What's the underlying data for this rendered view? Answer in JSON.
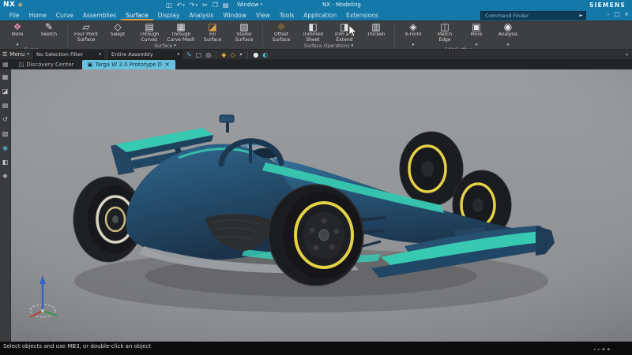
{
  "theme": {
    "blue": "#1478a8",
    "ribbon-bg": "#3e3f41",
    "accent": "#2fc7ae",
    "body-blue": "#1d4a6b",
    "body-dark": "#16354f",
    "yellow": "#e4cf3e",
    "viewport-bg": "#8f9194",
    "active-tab": "#68c2df",
    "orange": "#d79a46"
  },
  "glyphs": {
    "caret": "▾",
    "search": "►",
    "menu": "☰"
  },
  "titlebar": {
    "logo": "NX",
    "badge": {
      "glyph": "❖",
      "name": "app-badge-icon",
      "color": "#d8b36a"
    },
    "title": "NX - Modeling",
    "brand": "SIEMENS",
    "window_menu_label": "Window",
    "quick_access": [
      {
        "glyph": "◫",
        "name": "save-icon"
      },
      {
        "glyph": "↶",
        "name": "undo-icon",
        "caret": "▾"
      },
      {
        "glyph": "↷",
        "name": "redo-icon",
        "caret": "▾"
      },
      {
        "glyph": "✂",
        "name": "cut-icon"
      },
      {
        "glyph": "❐",
        "name": "copy-icon"
      },
      {
        "glyph": "▤",
        "name": "paste-icon"
      }
    ]
  },
  "window_controls": [
    {
      "glyph": "–",
      "name": "minimize-button"
    },
    {
      "glyph": "□",
      "name": "maximize-button"
    },
    {
      "glyph": "×",
      "name": "close-button"
    }
  ],
  "menubar": {
    "tabs": [
      {
        "label": "File"
      },
      {
        "label": "Home"
      },
      {
        "label": "Curve"
      },
      {
        "label": "Assemblies"
      },
      {
        "label": "Surface",
        "active": true
      },
      {
        "label": "Display"
      },
      {
        "label": "Analysis"
      },
      {
        "label": "Window"
      },
      {
        "label": "View"
      },
      {
        "label": "Tools"
      },
      {
        "label": "Application"
      },
      {
        "label": "Extensions"
      }
    ],
    "search_placeholder": "Command Finder"
  },
  "ribbon": {
    "groups": [
      {
        "caption": "Curve",
        "items": [
          {
            "label": "More",
            "glyph": "❖",
            "color": "#df8cab",
            "name": "more-curve-icon",
            "caret": "▾"
          },
          {
            "label": "Sketch",
            "glyph": "✎",
            "color": "#e8e9ea",
            "name": "sketch-icon"
          }
        ]
      },
      {
        "caption": "Surface",
        "items": [
          {
            "label": "Four Point\nSurface",
            "glyph": "▱",
            "name": "four-point-surface-icon"
          },
          {
            "label": "Swept",
            "glyph": "◇",
            "name": "swept-icon"
          },
          {
            "label": "Through\nCurves",
            "glyph": "▤",
            "name": "through-curves-icon"
          },
          {
            "label": "Through\nCurve Mesh",
            "glyph": "▦",
            "name": "through-curve-mesh-icon"
          },
          {
            "label": "Fill\nSurface",
            "glyph": "◪",
            "color": "#e2a33c",
            "name": "fill-surface-icon"
          },
          {
            "label": "Studio\nSurface",
            "glyph": "▧",
            "name": "studio-surface-icon"
          }
        ]
      },
      {
        "caption": "Surface Operations",
        "items": [
          {
            "label": "Offset\nSurface",
            "glyph": "☼",
            "color": "#e2a33c",
            "name": "offset-surface-icon"
          },
          {
            "label": "Trimmed\nSheet",
            "glyph": "◧",
            "name": "trimmed-sheet-icon"
          },
          {
            "label": "Trim and\nExtend",
            "glyph": "◨",
            "name": "trim-and-extend-icon"
          },
          {
            "label": "Thicken",
            "glyph": "▥",
            "name": "thicken-icon"
          }
        ]
      },
      {
        "caption": "Edit Surface",
        "items": [
          {
            "label": "X-Form",
            "glyph": "◈",
            "name": "x-form-icon",
            "caret": "▾"
          },
          {
            "label": "Match\nEdge",
            "glyph": "◫",
            "name": "match-edge-icon"
          },
          {
            "label": "More",
            "glyph": "▣",
            "name": "more-surface-icon",
            "caret": "▾"
          },
          {
            "label": "Analysis",
            "glyph": "◉",
            "name": "analyze-shape-icon",
            "caret": "▾"
          }
        ]
      }
    ]
  },
  "border_bar": {
    "menu_label": "Menu",
    "filter_value": "No Selection Filter",
    "scope_value": "Entire Assembly",
    "icons": [
      {
        "glyph": "✎",
        "color": "#57b8d8",
        "name": "paint-selection-icon"
      },
      {
        "glyph": "▢",
        "name": "rectangle-select-icon"
      },
      {
        "glyph": "◎",
        "name": "find-in-window-icon"
      },
      {
        "type": "divider"
      },
      {
        "glyph": "◆",
        "color": "#dfa23e",
        "name": "snap-point-icon"
      },
      {
        "glyph": "◇",
        "color": "#dfa23e",
        "name": "snap-endpoint-icon"
      },
      {
        "glyph": "•",
        "name": "snap-midpoint-icon"
      },
      {
        "type": "divider"
      },
      {
        "glyph": "●",
        "color": "#e8e9ea",
        "name": "shaded-display-icon"
      },
      {
        "glyph": "◐",
        "color": "#57b8d8",
        "name": "render-style-icon"
      }
    ],
    "overflow_glyph": "▾"
  },
  "part_tabs": {
    "panel_glyph": "▦",
    "tabs": [
      {
        "icon": "◳",
        "label": "Discovery Center"
      },
      {
        "icon": "▣",
        "label": "Targa W 2.0 Prototype D",
        "close": "×",
        "active": true
      }
    ]
  },
  "resource_bar": {
    "icons": [
      {
        "glyph": "▦",
        "name": "assembly-navigator-icon"
      },
      {
        "glyph": "◪",
        "name": "constraint-navigator-icon"
      },
      {
        "glyph": "▤",
        "name": "part-navigator-icon"
      },
      {
        "glyph": "↺",
        "name": "history-icon"
      },
      {
        "glyph": "▧",
        "name": "reuse-library-icon"
      },
      {
        "glyph": "◉",
        "color": "#4fa8d5",
        "name": "web-browser-icon"
      },
      {
        "glyph": "◧",
        "name": "hd3d-tools-icon"
      },
      {
        "glyph": "❖",
        "name": "roles-icon"
      }
    ]
  },
  "statusbar": {
    "message": "Select objects and use MB3, or double-click an object",
    "icons": [
      {
        "glyph": "◂",
        "name": "alert-prev-icon"
      },
      {
        "glyph": "▸",
        "name": "alert-next-icon"
      },
      {
        "glyph": "▪",
        "name": "status-dot-icon"
      },
      {
        "glyph": "▪",
        "name": "status-dot-2-icon"
      }
    ]
  }
}
